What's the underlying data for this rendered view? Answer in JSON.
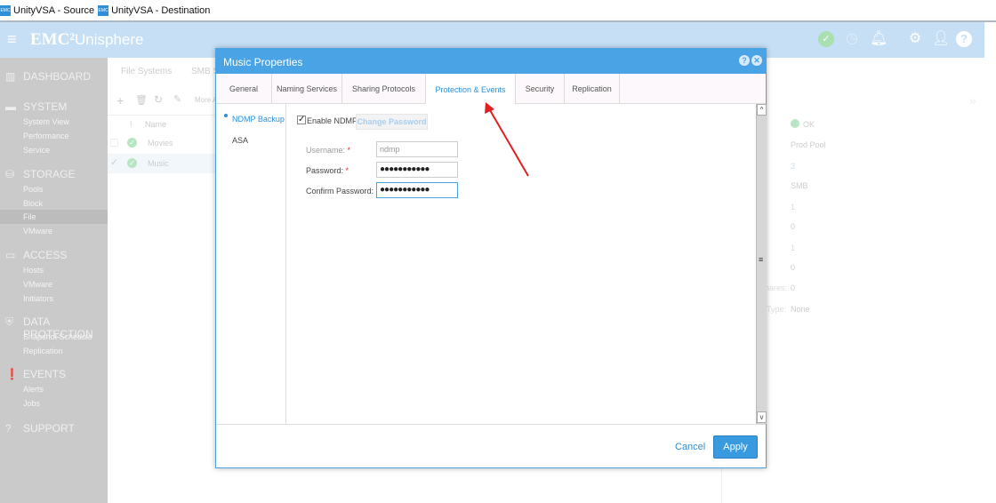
{
  "window_tabs": [
    {
      "label": "UnityVSA - Source",
      "icon": "EMC"
    },
    {
      "label": "UnityVSA - Destination",
      "icon": "EMC"
    }
  ],
  "header": {
    "logo": "EMC²",
    "app": "Unisphere",
    "icons": [
      "health-ok-icon",
      "jobs-icon",
      "alerts-bell-icon",
      "settings-gear-icon",
      "user-icon",
      "help-icon"
    ]
  },
  "sidebar": {
    "sections": [
      {
        "label": "DASHBOARD",
        "icon": "dashboard-icon",
        "items": []
      },
      {
        "label": "SYSTEM",
        "icon": "system-icon",
        "items": [
          "System View",
          "Performance",
          "Service"
        ]
      },
      {
        "label": "STORAGE",
        "icon": "storage-icon",
        "items": [
          "Pools",
          "Block",
          "File",
          "VMware"
        ]
      },
      {
        "label": "ACCESS",
        "icon": "access-icon",
        "items": [
          "Hosts",
          "VMware",
          "Initiators"
        ]
      },
      {
        "label": "DATA PROTECTION",
        "icon": "shield-icon",
        "items": [
          "Snapshot Schedule",
          "Replication"
        ]
      },
      {
        "label": "EVENTS",
        "icon": "events-icon",
        "items": [
          "Alerts",
          "Jobs"
        ]
      },
      {
        "label": "SUPPORT",
        "icon": "support-icon",
        "items": []
      }
    ],
    "selected": "File"
  },
  "main": {
    "tabs": [
      "File Systems",
      "SMB S"
    ],
    "toolbar_more": "More A",
    "columns": [
      "!",
      "Name"
    ],
    "rows": [
      {
        "name": "Movies",
        "status": "ok",
        "checked": false
      },
      {
        "name": "Music",
        "status": "ok",
        "checked": true
      }
    ]
  },
  "details": {
    "values": [
      {
        "label": "",
        "value": "OK"
      },
      {
        "label": "",
        "value": "Prod Pool"
      },
      {
        "label": "s:",
        "value": "3"
      },
      {
        "label": "",
        "value": "SMB"
      },
      {
        "label": ":",
        "value": "1"
      },
      {
        "label": ":",
        "value": "0"
      },
      {
        "label": ":",
        "value": "1"
      },
      {
        "label": "",
        "value": "0"
      },
      {
        "label": "hares:",
        "value": "0"
      },
      {
        "label": "Type:",
        "value": "None"
      }
    ]
  },
  "dialog": {
    "title": "Music Properties",
    "tabs": [
      "General",
      "Naming Services",
      "Sharing Protocols",
      "Protection & Events",
      "Security",
      "Replication"
    ],
    "active_tab": "Protection & Events",
    "nav": [
      "NDMP Backup",
      "ASA"
    ],
    "active_nav": "NDMP Backup",
    "enable_ndmp_label": "Enable NDMP",
    "enable_ndmp_checked": true,
    "change_password": "Change Password",
    "username_label": "Username:",
    "username_value": "ndmp",
    "password_label": "Password:",
    "password_value": "●●●●●●●●●●●",
    "confirm_label": "Confirm Password:",
    "confirm_value": "●●●●●●●●●●●",
    "required_mark": "*",
    "cancel": "Cancel",
    "apply": "Apply"
  },
  "annotation": {
    "arrow_color": "#e02020",
    "points_to": "Protection & Events"
  }
}
